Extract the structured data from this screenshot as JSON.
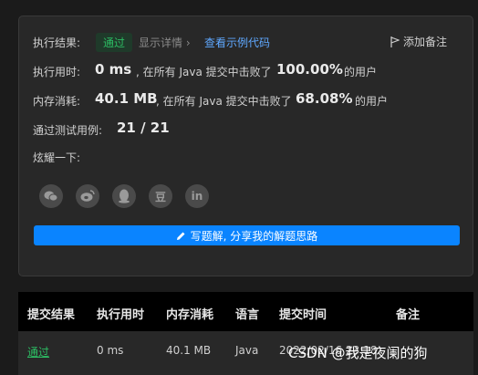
{
  "result": {
    "label": "执行结果:",
    "status": "通过",
    "details_link": "显示详情 ›",
    "sample_code_link": "查看示例代码",
    "add_note": "添加备注"
  },
  "runtime": {
    "label": "执行用时:",
    "value": "0 ms",
    "text_mid": ", 在所有 Java 提交中击败了",
    "percent": "100.00%",
    "text_end": "的用户"
  },
  "memory": {
    "label": "内存消耗:",
    "value": "40.1 MB",
    "text_mid": ", 在所有 Java 提交中击败了",
    "percent": "68.08%",
    "text_end": "的用户"
  },
  "tests": {
    "label": "通过测试用例:",
    "value": "21 / 21"
  },
  "share": {
    "label": "炫耀一下:",
    "icons": [
      "wechat-icon",
      "weibo-icon",
      "qq-icon",
      "douban-icon",
      "linkedin-icon"
    ],
    "douban_glyph": "豆",
    "linkedin_glyph": "in"
  },
  "write_button": "写题解, 分享我的解题思路",
  "table": {
    "headers": [
      "提交结果",
      "执行用时",
      "内存消耗",
      "语言",
      "提交时间",
      "备注"
    ],
    "row": {
      "status": "通过",
      "runtime": "0 ms",
      "memory": "40.1 MB",
      "language": "Java",
      "time": "2022/02/16 23:18"
    }
  },
  "watermark": "CSDN @我是夜阑的狗",
  "colors": {
    "pass": "#2cbc63",
    "link": "#5fa8ff",
    "button": "#0a84ff",
    "card": "#282828"
  }
}
